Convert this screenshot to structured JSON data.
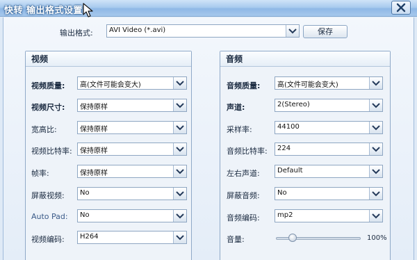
{
  "window": {
    "title": "快转 输出格式设置"
  },
  "output": {
    "label": "输出格式:",
    "value": "AVI Video (*.avi)",
    "save_label": "保存"
  },
  "video": {
    "title": "视频",
    "rows": [
      {
        "label": "视频质量:",
        "value": "高(文件可能会变大)"
      },
      {
        "label": "视频尺寸:",
        "value": "保持原样"
      },
      {
        "label": "宽高比:",
        "value": "保持原样"
      },
      {
        "label": "视频比特率:",
        "value": "保持原样"
      },
      {
        "label": "帧率:",
        "value": "保持原样"
      },
      {
        "label": "屏蔽视频:",
        "value": "No"
      },
      {
        "label": "Auto Pad:",
        "value": "No"
      },
      {
        "label": "视频编码:",
        "value": "H264"
      }
    ]
  },
  "audio": {
    "title": "音频",
    "rows": [
      {
        "label": "音频质量:",
        "value": "高(文件可能会变大)"
      },
      {
        "label": "声道:",
        "value": "2(Stereo)"
      },
      {
        "label": "采样率:",
        "value": "44100"
      },
      {
        "label": "音频比特率:",
        "value": "224"
      },
      {
        "label": "左右声道:",
        "value": "Default"
      },
      {
        "label": "屏蔽音频:",
        "value": "No"
      },
      {
        "label": "音频编码:",
        "value": "mp2"
      }
    ],
    "volume_label": "音量:",
    "volume_value": "100%",
    "volume_slider_position": 0.2
  },
  "icons": {
    "close": "close-icon",
    "dropdown": "chevron-down-icon",
    "cursor": "mouse-pointer-icon"
  },
  "colors": {
    "titlebar": "#a9cbee",
    "background": "#dfeaf6"
  }
}
